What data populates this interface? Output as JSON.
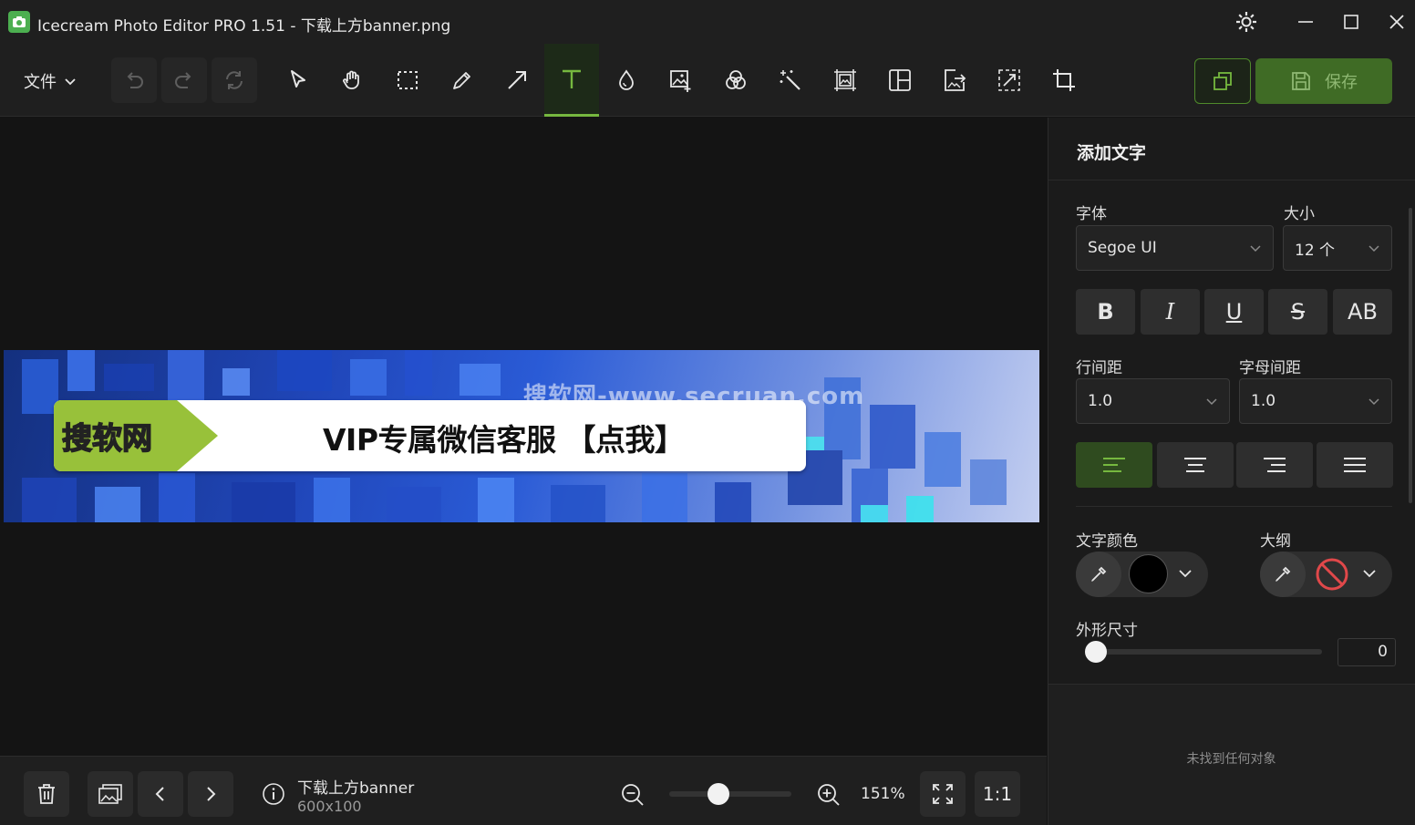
{
  "window": {
    "title": "Icecream Photo Editor PRO 1.51 - 下载上方banner.png"
  },
  "toolbar": {
    "file_menu": "文件",
    "save_label": "保存",
    "tools": [
      "undo-icon",
      "redo-icon",
      "reset-icon",
      "select-icon",
      "hand-icon",
      "marquee-icon",
      "pencil-icon",
      "arrow-icon",
      "text-icon",
      "drop-icon",
      "add-image-icon",
      "filters-icon",
      "magic-wand-icon",
      "resize-icon",
      "collage-icon",
      "export-icon",
      "crop-select-icon",
      "crop-icon"
    ],
    "active_tool": "text-icon"
  },
  "banner": {
    "logo_text": "搜软网",
    "headline": "VIP专属微信客服 【点我】",
    "watermark": "搜软网-www.secruan.com"
  },
  "panel": {
    "title": "添加文字",
    "font_label": "字体",
    "font_value": "Segoe UI",
    "size_label": "大小",
    "size_value": "12 个",
    "format": {
      "bold": "B",
      "italic": "I",
      "underline": "U",
      "strike": "S",
      "caps": "AB"
    },
    "line_spacing_label": "行间距",
    "line_spacing_value": "1.0",
    "letter_spacing_label": "字母间距",
    "letter_spacing_value": "1.0",
    "text_color_label": "文字颜色",
    "outline_label": "大纲",
    "shape_size_label": "外形尺寸",
    "shape_size_value": "0",
    "shape_size_level": 0,
    "empty_message": "未找到任何对象"
  },
  "bottombar": {
    "file_name": "下载上方banner",
    "file_dims": "600x100",
    "zoom_value": "151%",
    "zoom_level": 0.4,
    "one_to_one": "1:1"
  },
  "colors": {
    "accent": "#76b83f",
    "save_bg": "#3f6b25",
    "text_color": "#000000",
    "outline": "#e0484a"
  }
}
